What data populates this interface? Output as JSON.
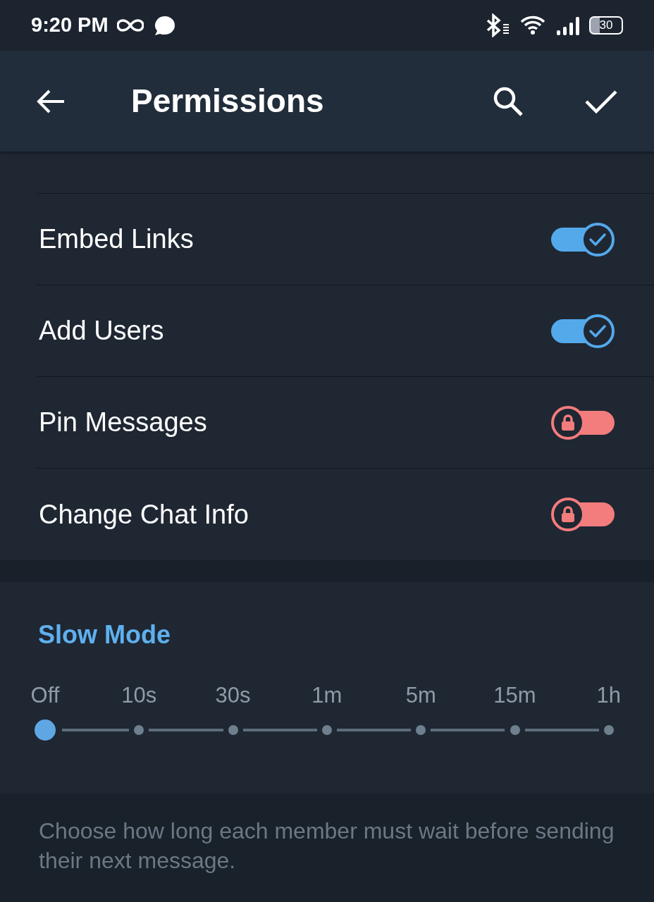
{
  "status_bar": {
    "time": "9:20 PM",
    "battery": "30"
  },
  "header": {
    "title": "Permissions"
  },
  "permissions": [
    {
      "label": "Embed Links",
      "on": true,
      "locked": false
    },
    {
      "label": "Add Users",
      "on": true,
      "locked": false
    },
    {
      "label": "Pin Messages",
      "on": false,
      "locked": true
    },
    {
      "label": "Change Chat Info",
      "on": false,
      "locked": true
    }
  ],
  "slow_mode": {
    "title": "Slow Mode",
    "options": [
      "Off",
      "10s",
      "30s",
      "1m",
      "5m",
      "15m",
      "1h"
    ],
    "level": 0,
    "hint": "Choose how long each member must wait before sending their next message."
  }
}
